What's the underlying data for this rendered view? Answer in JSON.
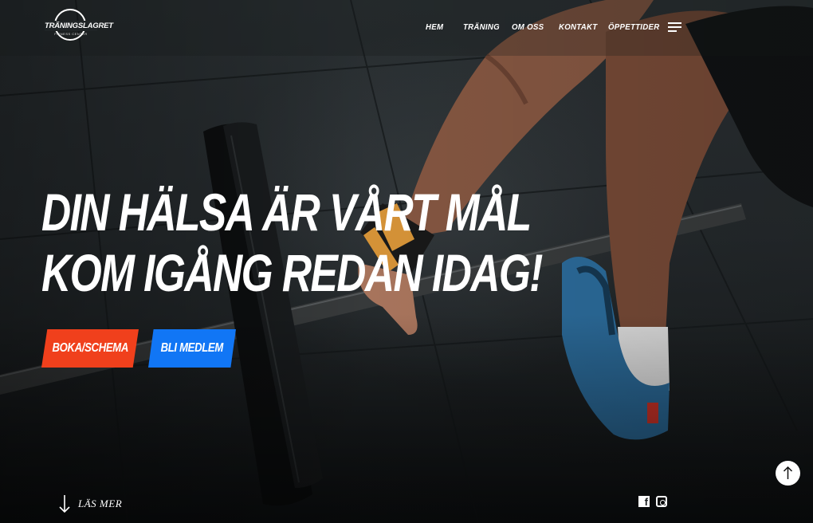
{
  "brand": {
    "logo_text": "TRÄNINGSLAGRET",
    "logo_subtext": "FITNESS CENTER"
  },
  "nav": {
    "items": [
      {
        "label": "HEM"
      },
      {
        "label": "TRÄNING"
      },
      {
        "label": "OM OSS"
      },
      {
        "label": "KONTAKT"
      },
      {
        "label": "ÖPPETTIDER"
      }
    ],
    "menu_icon": "hamburger-menu-icon"
  },
  "hero": {
    "headline_line1": "DIN HÄLSA ÄR VÅRT MÅL",
    "headline_line2": "KOM IGÅNG REDAN IDAG!",
    "buttons": {
      "book": "BOKA/SCHEMA",
      "join": "BLI MEDLEM"
    },
    "read_more": "LÄS MER"
  },
  "social": {
    "facebook_icon": "facebook-icon",
    "instagram_icon": "instagram-icon"
  },
  "back_to_top_icon": "arrow-up-icon",
  "colors": {
    "book_button": "#f0401c",
    "join_button": "#1176f5",
    "text": "#ffffff",
    "background": "#262b2e"
  }
}
